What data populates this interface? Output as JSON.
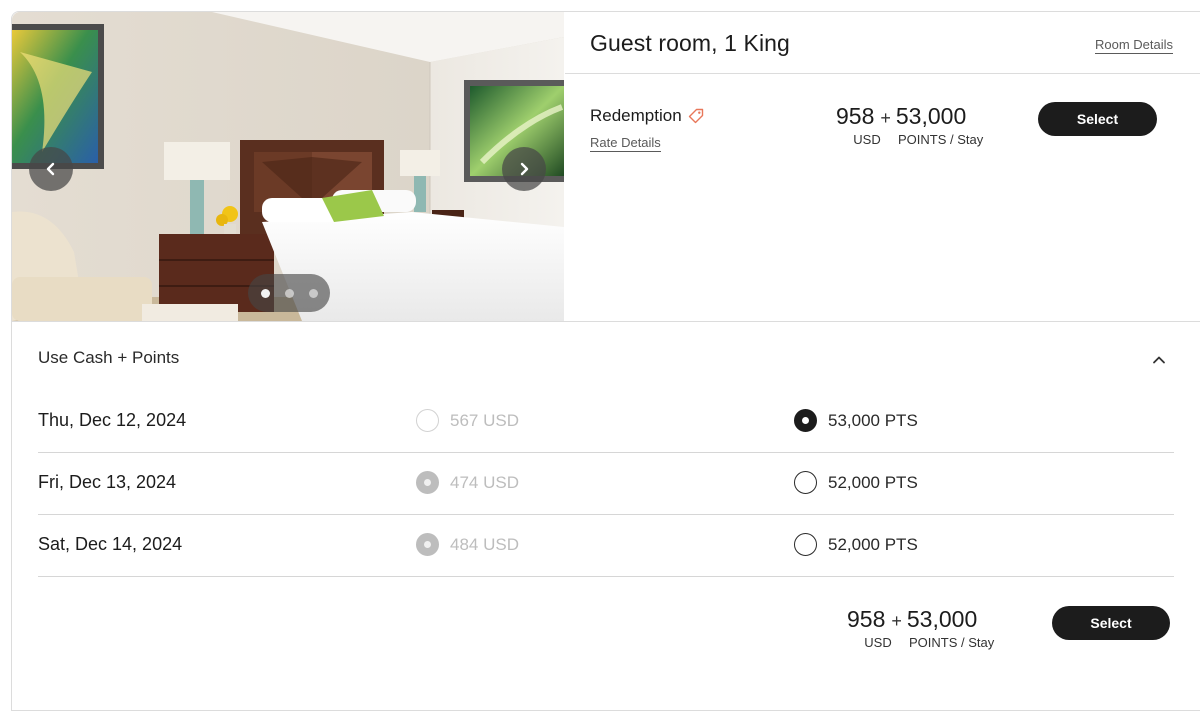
{
  "room": {
    "title": "Guest room, 1 King",
    "details_link": "Room Details"
  },
  "gallery": {
    "prev_icon": "chevron-left-icon",
    "next_icon": "chevron-right-icon",
    "slide_count": 3,
    "active_slide": 1
  },
  "rate": {
    "name": "Redemption",
    "tag_icon": "tag-icon",
    "tag_color": "#e8775a",
    "details_link": "Rate Details",
    "cash_amount": "958",
    "plus": "+",
    "points_amount": "53,000",
    "cash_unit": "USD",
    "points_unit": "POINTS / Stay",
    "select_label": "Select"
  },
  "cash_points": {
    "title": "Use Cash + Points",
    "collapse_icon": "chevron-up-icon",
    "nights": [
      {
        "date": "Thu, Dec 12, 2024",
        "cash": "567 USD",
        "points": "53,000 PTS",
        "selected": "points"
      },
      {
        "date": "Fri, Dec 13, 2024",
        "cash": "474 USD",
        "points": "52,000 PTS",
        "selected": "none"
      },
      {
        "date": "Sat, Dec 14, 2024",
        "cash": "484 USD",
        "points": "52,000 PTS",
        "selected": "none"
      }
    ],
    "total": {
      "cash_amount": "958",
      "plus": "+",
      "points_amount": "53,000",
      "cash_unit": "USD",
      "points_unit": "POINTS / Stay",
      "select_label": "Select"
    }
  }
}
